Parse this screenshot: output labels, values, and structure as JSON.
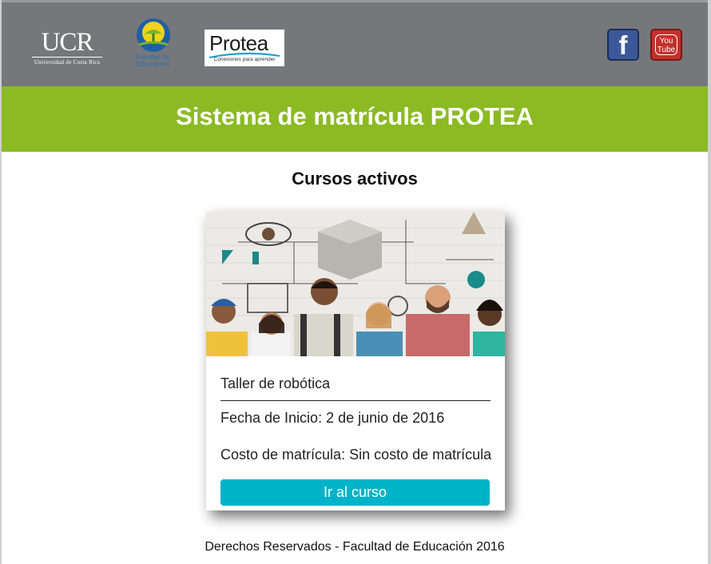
{
  "header": {
    "ucr_logo_text": "UCR",
    "ucr_logo_subtext": "Universidad de Costa Rica",
    "faculty_logo_line1": "Facultad de",
    "faculty_logo_line2": "Educación",
    "protea_logo_text": "Protea",
    "protea_logo_tagline": "Conexiones para aprender",
    "facebook_glyph": "f",
    "youtube_line1": "You",
    "youtube_line2": "Tube",
    "background_color": "#76777a"
  },
  "title_bar": {
    "title": "Sistema de matrícula PROTEA",
    "background_color": "#8bba23"
  },
  "main": {
    "section_title": "Cursos activos",
    "courses": [
      {
        "name": "Taller de robótica",
        "start_date": "Fecha de Inicio: 2 de junio de 2016",
        "cost": "Costo de matrícula: Sin costo de matrícula",
        "button_label": "Ir al curso",
        "button_color": "#00b3c9"
      }
    ]
  },
  "footer": {
    "text": "Derechos Reservados - Facultad de Educación 2016"
  }
}
